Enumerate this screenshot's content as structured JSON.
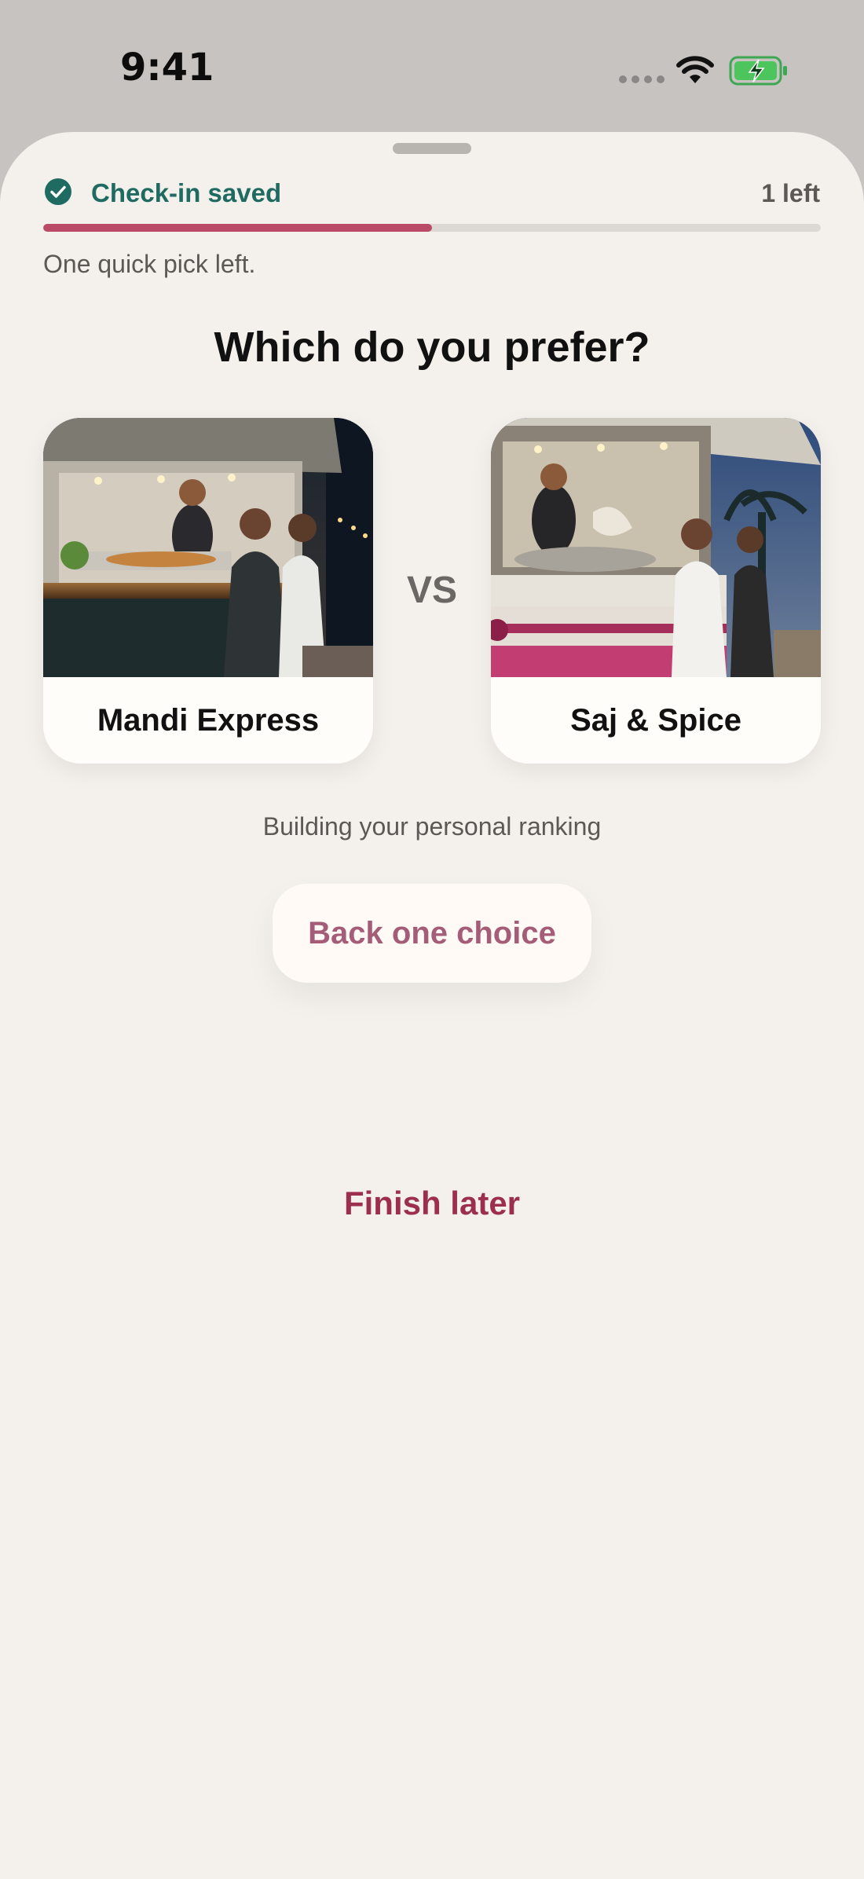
{
  "status_bar": {
    "time": "9:41"
  },
  "header": {
    "checkin_label": "Check-in saved",
    "left_count": "1 left",
    "progress_fraction": 0.5,
    "note": "One quick pick left."
  },
  "question": "Which do you prefer?",
  "options": [
    {
      "name": "Mandi Express"
    },
    {
      "name": "Saj & Spice"
    }
  ],
  "vs_label": "VS",
  "ranking_note": "Building your personal ranking",
  "actions": {
    "back_label": "Back one choice",
    "finish_label": "Finish later"
  },
  "colors": {
    "accent": "#bb4a66",
    "teal": "#1f6b62",
    "finish": "#9c2f4d",
    "back_text": "#a55d77"
  },
  "icons": {
    "check": "check-circle-icon",
    "wifi": "wifi-icon",
    "battery": "battery-charging-icon"
  }
}
